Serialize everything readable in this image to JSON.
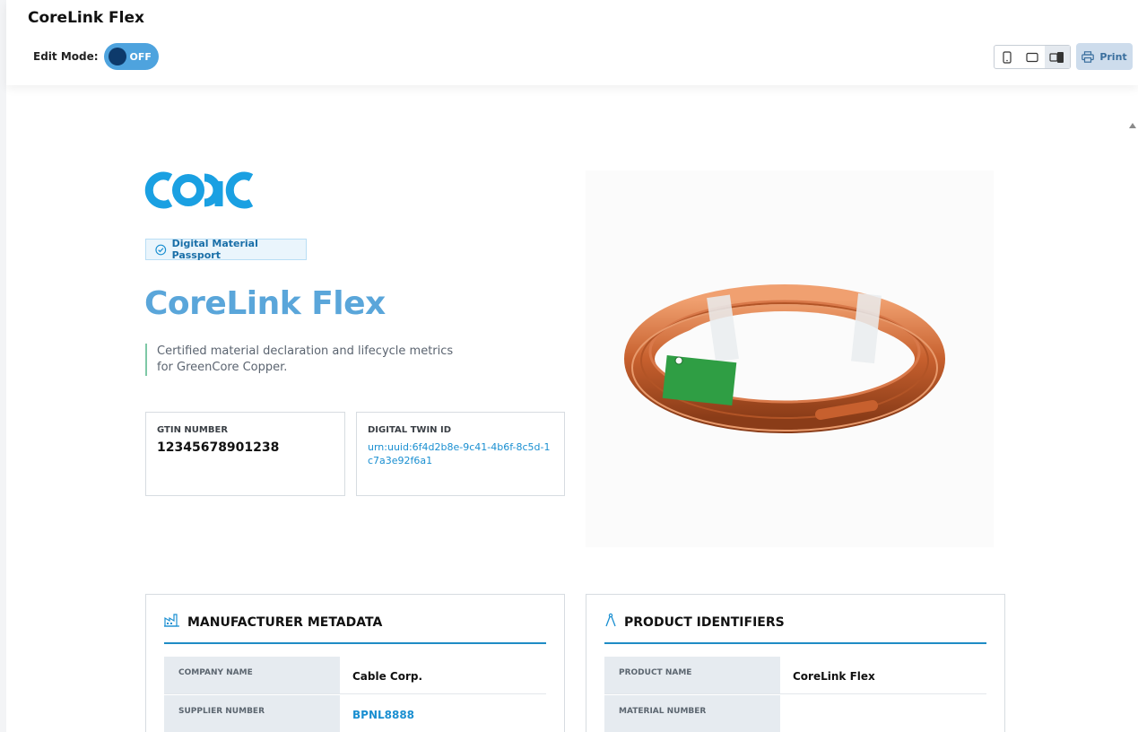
{
  "app": {
    "title": "CoreLink Flex"
  },
  "toolbar": {
    "edit_mode_label": "Edit Mode:",
    "edit_mode_state": "OFF",
    "print_label": "Print",
    "views": [
      "mobile-view-icon",
      "tablet-view-icon",
      "desktop-view-icon"
    ],
    "active_view": "desktop-view-icon"
  },
  "hero": {
    "logo_text": "COAC",
    "badge": "Digital Material Passport",
    "title": "CoreLink Flex",
    "description": "Certified material declaration and lifecycle metrics for GreenCore Copper.",
    "gtin": {
      "label": "GTIN NUMBER",
      "value": "12345678901238"
    },
    "twin": {
      "label": "DIGITAL TWIN ID",
      "value": "urn:uuid:6f4d2b8e-9c41-4b6f-8c5d-1c7a3e92f6a1"
    },
    "image_icon": "copper-coil-image"
  },
  "manufacturer": {
    "title": "MANUFACTURER METADATA",
    "icon": "factory-icon",
    "rows": [
      {
        "key": "COMPANY NAME",
        "value": "Cable Corp."
      },
      {
        "key": "SUPPLIER NUMBER",
        "value": "BPNL8888"
      }
    ]
  },
  "product": {
    "title": "PRODUCT IDENTIFIERS",
    "icon": "compass-icon",
    "rows": [
      {
        "key": "PRODUCT NAME",
        "value": "CoreLink Flex"
      },
      {
        "key": "MATERIAL NUMBER",
        "value": ""
      }
    ]
  },
  "colors": {
    "accent": "#1f8cc5",
    "title_blue": "#5aa6da",
    "toggle_bg": "#4ea3de",
    "toggle_knob": "#0d3a6b"
  }
}
